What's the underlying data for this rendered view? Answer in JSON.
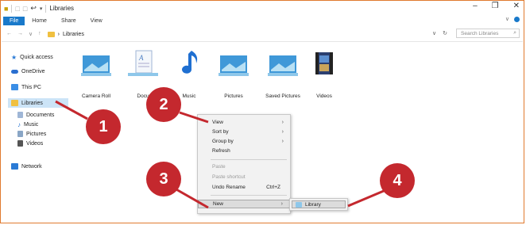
{
  "window": {
    "title": "Libraries",
    "controls": [
      "–",
      "❐",
      "✕"
    ]
  },
  "ribbon": {
    "tabs": [
      "File",
      "Home",
      "Share",
      "View"
    ],
    "right": [
      "∨"
    ]
  },
  "address": {
    "nav": [
      "←",
      "→",
      "∨",
      "↑"
    ],
    "path_sep": "›",
    "path": "Libraries",
    "tools": [
      "∨",
      "↻"
    ],
    "search_placeholder": "Search Libraries",
    "search_icon": "⌕"
  },
  "navpane": {
    "items": [
      {
        "label": "Quick access",
        "icon": "star-icon",
        "color": "#2a7ad5"
      },
      {
        "label": "OneDrive",
        "icon": "cloud-icon",
        "color": "#2a6fd0"
      },
      {
        "label": "This PC",
        "icon": "computer-icon",
        "color": "#3a8ee6"
      },
      {
        "label": "Libraries",
        "icon": "libraries-icon",
        "color": "#f0c040"
      },
      {
        "label": "Documents",
        "icon": "documents-icon",
        "color": "#9fb6d6"
      },
      {
        "label": "Music",
        "icon": "music-icon",
        "color": "#1f6fd1"
      },
      {
        "label": "Pictures",
        "icon": "pictures-icon",
        "color": "#8aa6c6"
      },
      {
        "label": "Videos",
        "icon": "videos-icon",
        "color": "#555555"
      },
      {
        "label": "Network",
        "icon": "network-icon",
        "color": "#2a7ad5"
      }
    ]
  },
  "libraries": [
    {
      "label": "Camera Roll",
      "icon": "camera-roll-icon"
    },
    {
      "label": "Docu",
      "icon": "documents-library-icon"
    },
    {
      "label": "Music",
      "icon": "music-library-icon"
    },
    {
      "label": "Pictures",
      "icon": "pictures-library-icon"
    },
    {
      "label": "Saved Pictures",
      "icon": "saved-pictures-icon"
    },
    {
      "label": "Videos",
      "icon": "videos-library-icon"
    }
  ],
  "context_menu": {
    "view": "View",
    "sort_by": "Sort by",
    "group_by": "Group by",
    "refresh": "Refresh",
    "paste": "Paste",
    "paste_shortcut": "Paste shortcut",
    "undo_rename": "Undo Rename",
    "undo_shortcut": "Ctrl+Z",
    "new": "New",
    "arrow": "›"
  },
  "submenu": {
    "library": "Library"
  },
  "badges": [
    "1",
    "2",
    "3",
    "4"
  ],
  "colors": {
    "accent": "#1979ca",
    "badge": "#c4282e",
    "frame": "#e07a2e"
  }
}
